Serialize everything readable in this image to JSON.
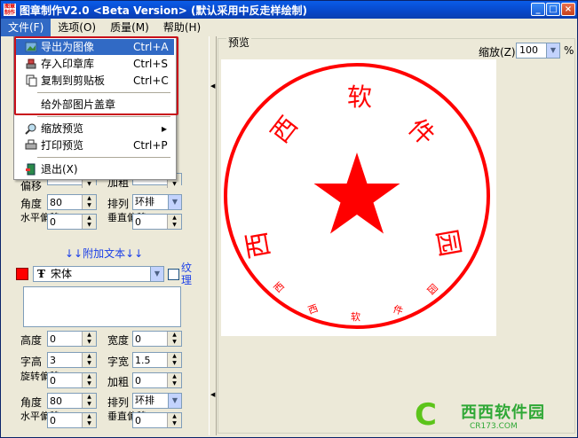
{
  "window": {
    "title": "图章制作V2.0 <Beta Version> (默认采用中反走样绘制)",
    "icon_text": "图章制作"
  },
  "menubar": [
    "文件(F)",
    "选项(O)",
    "质量(M)",
    "帮助(H)"
  ],
  "file_menu": [
    {
      "label": "导出为图像",
      "shortcut": "Ctrl+A",
      "icon": "export-image-icon"
    },
    {
      "label": "存入印章库",
      "shortcut": "Ctrl+S",
      "icon": "save-library-icon"
    },
    {
      "label": "复制到剪贴板",
      "shortcut": "Ctrl+C",
      "icon": "copy-icon"
    },
    {
      "label": "给外部图片盖章",
      "shortcut": "",
      "icon": ""
    },
    {
      "label": "缩放预览",
      "shortcut": "",
      "icon": "zoom-icon"
    },
    {
      "label": "打印预览",
      "shortcut": "Ctrl+P",
      "icon": "print-icon"
    },
    {
      "label": "退出(X)",
      "shortcut": "",
      "icon": "exit-icon"
    }
  ],
  "upper_fields": {
    "offset_label": "偏移",
    "bold_label": "加粗",
    "angle_label": "角度",
    "angle_value": "80",
    "arrange_label": "排列",
    "arrange_value": "环排",
    "hoffset_label": "水平偏移",
    "hoffset_value": "0",
    "voffset_label": "垂直偏移",
    "voffset_value": "0"
  },
  "addtext_label": "↓↓附加文本↓↓",
  "font": {
    "name": "宋体",
    "icon": "truetype-icon",
    "texture_label": "纹理",
    "color": "#ff0000"
  },
  "lower_fields": {
    "height_label": "高度",
    "height_value": "0",
    "width_label": "宽度",
    "width_value": "0",
    "char_height_label": "字高",
    "char_height_value": "3",
    "char_width_label": "字宽",
    "char_width_value": "1.5",
    "rotate_label": "旋转偏移",
    "rotate_value": "0",
    "bold_label": "加粗",
    "bold_value": "0",
    "angle_label": "角度",
    "angle_value": "80",
    "arrange_label": "排列",
    "arrange_value": "环排",
    "hoffset_label": "水平偏移",
    "hoffset_value": "0",
    "voffset_label": "垂直偏移",
    "voffset_value": "0"
  },
  "preview": {
    "group_label": "预览",
    "zoom_label": "缩放(Z)",
    "zoom_value": "100",
    "zoom_unit": "%",
    "seal_color": "#ff0000",
    "arc_text": [
      "西",
      "西",
      "软",
      "件",
      "园"
    ],
    "inner_text": [
      "西",
      "西",
      "软",
      "件",
      "园"
    ]
  },
  "watermark": {
    "text": "西西软件园",
    "sub": "CR173.COM"
  }
}
